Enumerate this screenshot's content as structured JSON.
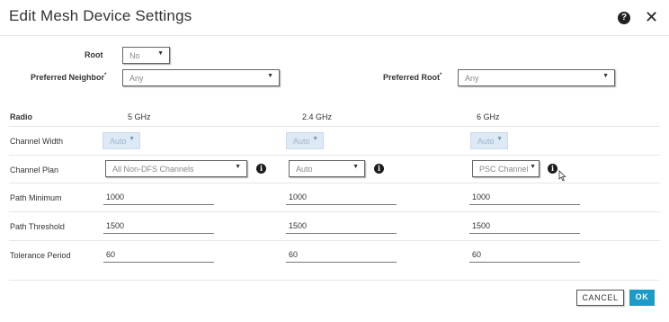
{
  "dialog": {
    "title": "Edit Mesh Device Settings",
    "help_icon": "question-circle-icon",
    "close_icon": "close-x-icon"
  },
  "top_fields": {
    "root": {
      "label": "Root",
      "value": "No"
    },
    "preferred_neighbor": {
      "label": "Preferred Neighbor",
      "required_mark": "*",
      "value": "Any"
    },
    "preferred_root": {
      "label": "Preferred Root",
      "required_mark": "*",
      "value": "Any"
    }
  },
  "table": {
    "radio_header": "Radio",
    "columns": [
      "5 GHz",
      "2.4 GHz",
      "6 GHz"
    ],
    "rows": {
      "channel_width": {
        "label": "Channel Width",
        "values": [
          "Auto",
          "Auto",
          "Auto"
        ]
      },
      "channel_plan": {
        "label": "Channel Plan",
        "values": [
          "All Non-DFS Channels",
          "Auto",
          "PSC Channel"
        ]
      },
      "path_minimum": {
        "label": "Path Minimum",
        "values": [
          "1000",
          "1000",
          "1000"
        ]
      },
      "path_threshold": {
        "label": "Path Threshold",
        "values": [
          "1500",
          "1500",
          "1500"
        ]
      },
      "tolerance_period": {
        "label": "Tolerance Period",
        "values": [
          "60",
          "60",
          "60"
        ]
      }
    }
  },
  "footer": {
    "cancel_label": "CANCEL",
    "ok_label": "OK",
    "ok_color": "#1a9bc8"
  }
}
